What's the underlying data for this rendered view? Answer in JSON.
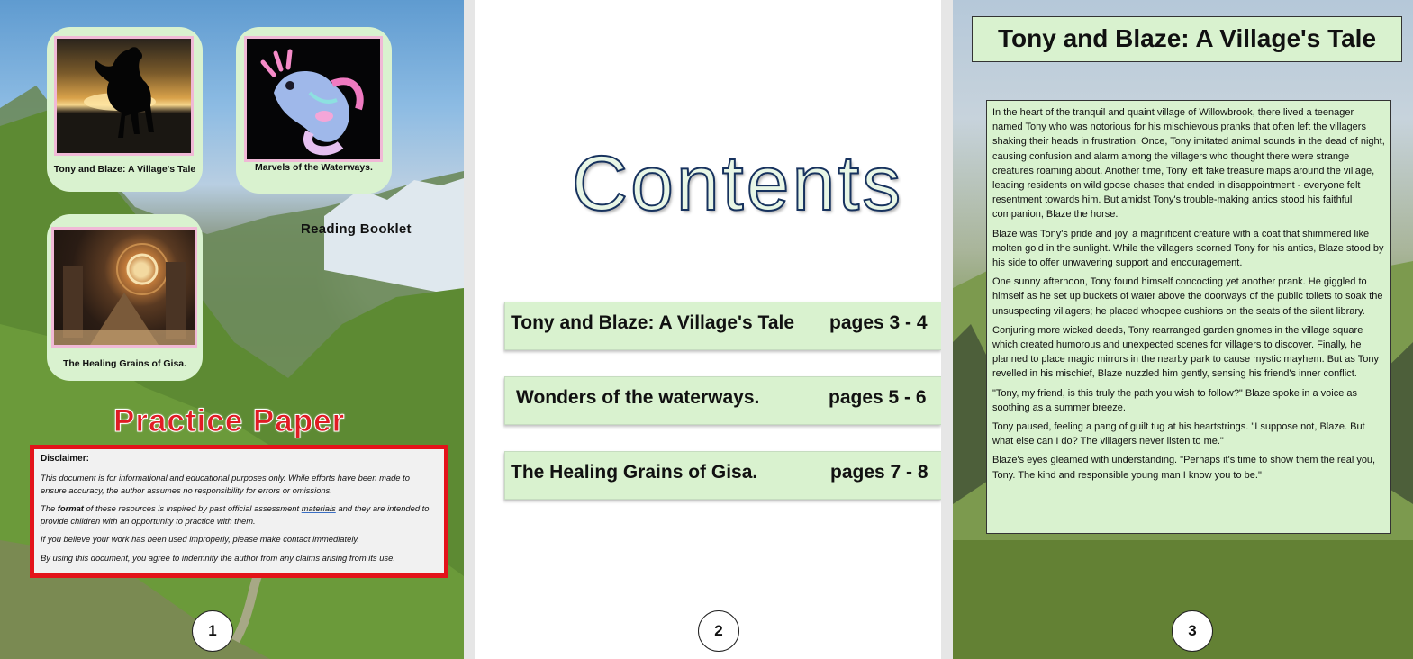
{
  "page1": {
    "cards": [
      {
        "caption": "Tony and Blaze: A Village's Tale",
        "image": "horse-silhouette-sunset-icon"
      },
      {
        "caption": "Marvels of the Waterways.",
        "image": "axolotl-illustration-icon"
      },
      {
        "caption": "The Healing Grains of Gisa.",
        "image": "ancient-cosmic-temple-icon"
      }
    ],
    "reading_booklet": "Reading Booklet",
    "practice_title": "Practice Paper",
    "disclaimer": {
      "title": "Disclaimer:",
      "p1": "This document is for informational and educational purposes only. While efforts have been made to ensure accuracy, the author assumes no responsibility for errors or omissions.",
      "p2_pre": "The ",
      "p2_bold": "format",
      "p2_mid": " of these resources is inspired by past official assessment ",
      "p2_underlined": "materials",
      "p2_post": " and they are intended to provide children with an opportunity to practice with them.",
      "p3": "If you believe your work has been used improperly, please make contact immediately.",
      "p4": "By using this document, you agree to indemnify the author from any claims arising from its use."
    },
    "page_number": "1"
  },
  "page2": {
    "title": "Contents",
    "toc": [
      {
        "title": "Tony and Blaze: A Village's Tale",
        "pages": "pages 3 - 4"
      },
      {
        "title": "Wonders of the waterways.",
        "pages": "pages 5 - 6"
      },
      {
        "title": "The Healing Grains of Gisa.",
        "pages": "pages 7 - 8"
      }
    ],
    "page_number": "2"
  },
  "page3": {
    "title": "Tony and Blaze: A Village's Tale",
    "paragraphs": [
      "In the heart of the tranquil and quaint village of Willowbrook, there lived a teenager named Tony who was notorious for his mischievous pranks that often left the villagers shaking their heads in frustration. Once, Tony imitated animal sounds in the dead of night, causing confusion and alarm among the villagers who thought there were strange creatures roaming about. Another time, Tony left fake treasure maps around the village, leading residents on wild goose chases that ended in disappointment - everyone felt resentment towards him. But amidst Tony's trouble-making antics stood his faithful companion, Blaze the horse.",
      "Blaze was Tony's pride and joy, a magnificent creature with a coat that shimmered like molten gold in the sunlight. While the villagers scorned Tony for his antics, Blaze stood by his side to offer unwavering support and encouragement.",
      "One sunny afternoon, Tony found himself concocting yet another prank. He giggled to himself as he set up buckets of water above the doorways of the public toilets to soak the unsuspecting villagers; he placed whoopee cushions on the seats of the silent library.",
      "Conjuring more wicked deeds, Tony rearranged garden gnomes in the village square which created humorous and unexpected scenes for villagers to discover. Finally, he planned to place magic mirrors in the nearby park to cause mystic mayhem. But as Tony revelled in his mischief, Blaze nuzzled him gently, sensing his friend's inner conflict.",
      "\"Tony, my friend, is this truly the path you wish to follow?\" Blaze spoke in a voice as soothing as a summer breeze.",
      "Tony paused, feeling a pang of guilt tug at his heartstrings. \"I suppose not, Blaze. But what else can I do? The villagers never listen to me.\"",
      "Blaze's eyes gleamed with understanding. \"Perhaps it's time to show them the real you, Tony. The kind and responsible young man I know you to be.\""
    ],
    "page_number": "3"
  }
}
